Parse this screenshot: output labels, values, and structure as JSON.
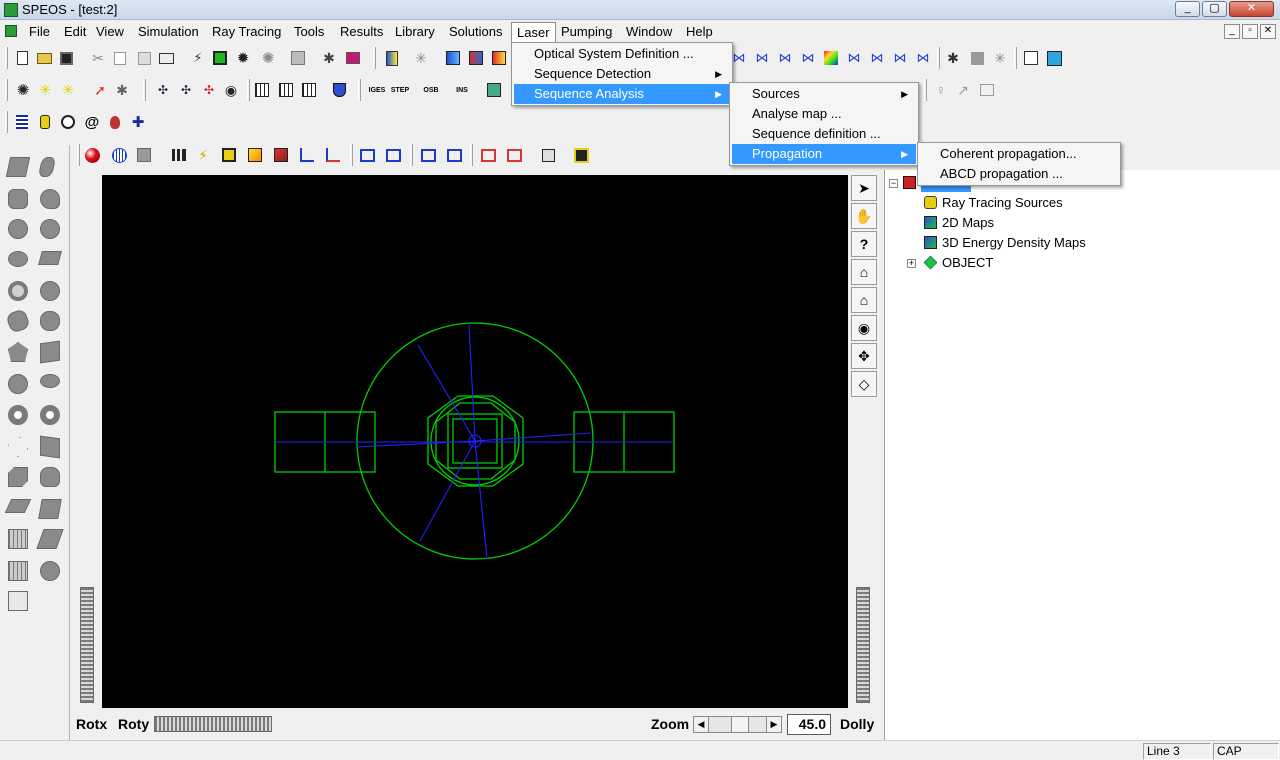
{
  "window": {
    "title": "SPEOS - [test:2]"
  },
  "menubar": {
    "items": [
      "File",
      "Edit",
      "View",
      "Simulation",
      "Ray Tracing",
      "Tools",
      "Results",
      "Library",
      "Solutions",
      "Laser",
      "Pumping",
      "Window",
      "Help"
    ]
  },
  "laser_menu": {
    "items": [
      "Optical System Definition ...",
      "Sequence Detection",
      "Sequence Analysis"
    ]
  },
  "sequence_analysis_menu": {
    "items": [
      "Sources",
      "Analyse map ...",
      "Sequence definition ...",
      "Propagation"
    ]
  },
  "propagation_menu": {
    "items": [
      "Coherent propagation...",
      "ABCD propagation ..."
    ]
  },
  "tree": {
    "items": [
      "Ray Tracing Sources",
      "2D Maps",
      "3D Energy Density Maps",
      "OBJECT"
    ]
  },
  "view_controls": {
    "rotx": "Rotx",
    "roty": "Roty",
    "zoom": "Zoom",
    "zoom_value": "45.0",
    "dolly": "Dolly"
  },
  "statusbar": {
    "line": "Line 3",
    "caps": "CAP"
  },
  "colors": {
    "highlight": "#3399ff",
    "geometry": "#00d000",
    "rays": "#0000ff",
    "viewport_bg": "#000000"
  },
  "icons": [
    "new-icon",
    "open-icon",
    "save-icon",
    "cut-icon",
    "copy-icon",
    "paste-icon",
    "print-icon",
    "select-arrow-icon",
    "pan-hand-icon",
    "help-icon",
    "home-icon",
    "home-set-icon",
    "eye-icon",
    "move-icon",
    "box-icon"
  ]
}
